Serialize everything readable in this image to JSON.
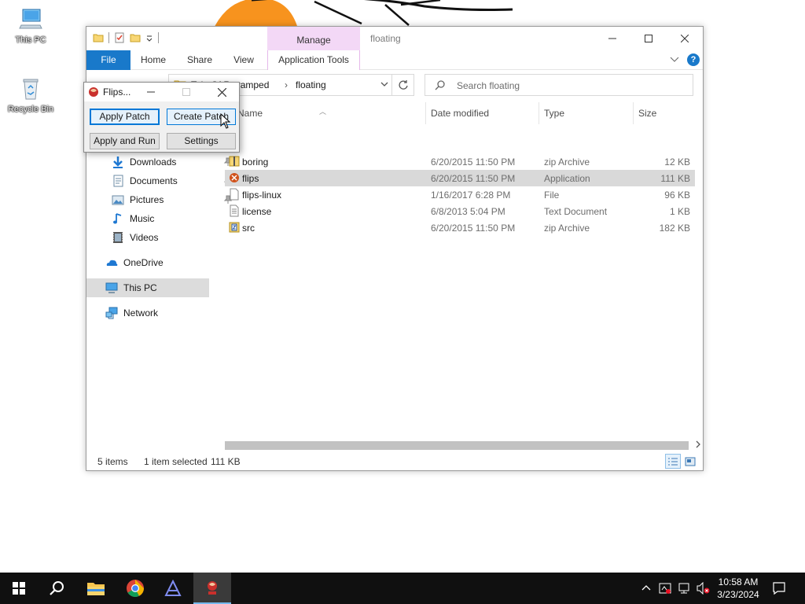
{
  "desktop": {
    "icons": [
      {
        "label": "This PC",
        "icon": "this-pc-icon"
      },
      {
        "label": "Recycle Bin",
        "icon": "recycle-bin-icon"
      }
    ]
  },
  "explorer": {
    "title": "floating",
    "contextual_tab_group": "Manage",
    "ribbon_tabs": [
      "File",
      "Home",
      "Share",
      "View",
      "Application Tools"
    ],
    "address": {
      "crumbs": [
        "Tale Of Revamped",
        "floating"
      ],
      "chevron": "›"
    },
    "search_placeholder": "Search floating",
    "nav": {
      "items": [
        {
          "label": "Downloads",
          "icon": "downloads-icon",
          "pinned": true
        },
        {
          "label": "Documents",
          "icon": "documents-icon",
          "pinned": true
        },
        {
          "label": "Pictures",
          "icon": "pictures-icon",
          "pinned": true
        },
        {
          "label": "Music",
          "icon": "music-icon",
          "pinned": false
        },
        {
          "label": "Videos",
          "icon": "videos-icon",
          "pinned": false
        },
        {
          "label": "OneDrive",
          "icon": "onedrive-icon",
          "pinned": false
        },
        {
          "label": "This PC",
          "icon": "this-pc-icon",
          "pinned": false,
          "selected": true
        },
        {
          "label": "Network",
          "icon": "network-icon",
          "pinned": false
        }
      ]
    },
    "columns": [
      "Name",
      "Date modified",
      "Type",
      "Size"
    ],
    "files": [
      {
        "name": "boring",
        "date": "6/20/2015 11:50 PM",
        "type": "zip Archive",
        "size": "12 KB",
        "icon": "zip-icon",
        "selected": false
      },
      {
        "name": "flips",
        "date": "6/20/2015 11:50 PM",
        "type": "Application",
        "size": "111 KB",
        "icon": "flips-app-icon",
        "selected": true
      },
      {
        "name": "flips-linux",
        "date": "1/16/2017 6:28 PM",
        "type": "File",
        "size": "96 KB",
        "icon": "file-icon",
        "selected": false
      },
      {
        "name": "license",
        "date": "6/8/2013 5:04 PM",
        "type": "Text Document",
        "size": "1 KB",
        "icon": "text-document-icon",
        "selected": false
      },
      {
        "name": "src",
        "date": "6/20/2015 11:50 PM",
        "type": "zip Archive",
        "size": "182 KB",
        "icon": "zip-icon",
        "selected": false
      }
    ],
    "status": {
      "item_count": "5 items",
      "selection": "1 item selected",
      "selection_size": "111 KB"
    }
  },
  "flips_dialog": {
    "title": "Flips...",
    "buttons": {
      "apply_patch": "Apply Patch",
      "create_patch": "Create Patch",
      "apply_and_run": "Apply and Run",
      "settings": "Settings"
    }
  },
  "taskbar": {
    "apps": [
      "start",
      "search",
      "file-explorer",
      "chrome",
      "app",
      "flips"
    ],
    "time": "10:58 AM",
    "date": "3/23/2024"
  },
  "colors": {
    "accent": "#1979ca",
    "manage_tab": "#f3d8f6",
    "taskbar": "#101010"
  }
}
